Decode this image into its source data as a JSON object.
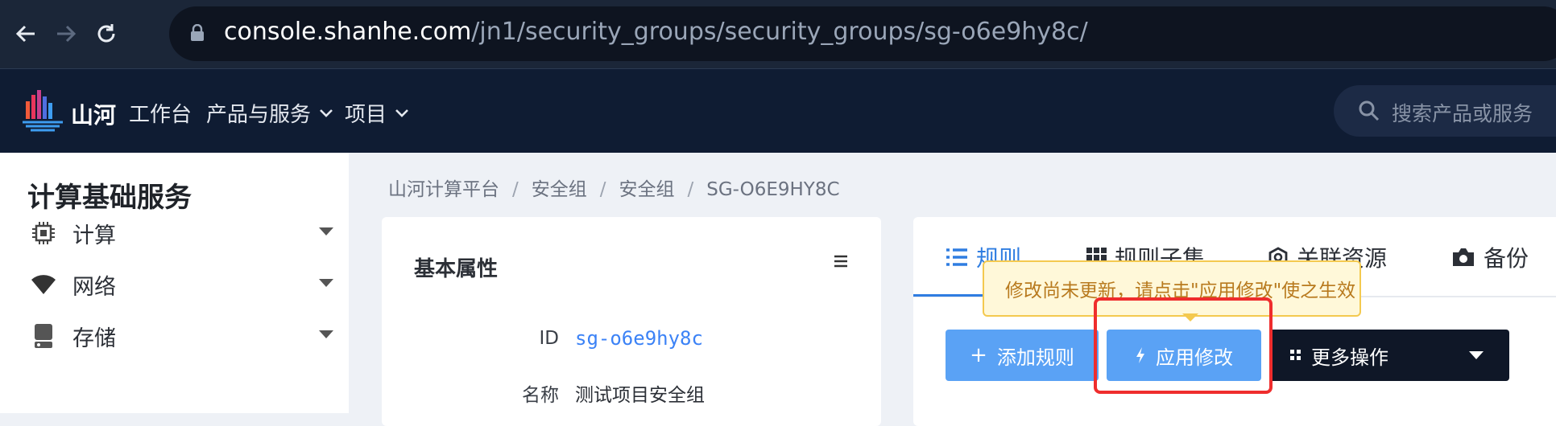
{
  "browser": {
    "url_host": "console.shanhe.com",
    "url_path": "/jn1/security_groups/security_groups/sg-o6e9hy8c/"
  },
  "topbar": {
    "brand": "山河",
    "nav": [
      {
        "label": "工作台"
      },
      {
        "label": "产品与服务"
      },
      {
        "label": "项目"
      }
    ],
    "search_placeholder": "搜索产品或服务"
  },
  "sidebar": {
    "title": "计算基础服务",
    "items": [
      {
        "label": "计算",
        "icon": "cpu-icon"
      },
      {
        "label": "网络",
        "icon": "wifi-icon"
      },
      {
        "label": "存储",
        "icon": "storage-icon"
      }
    ]
  },
  "breadcrumb": [
    "山河计算平台",
    "安全组",
    "安全组",
    "SG-O6E9HY8C"
  ],
  "basic_props": {
    "title": "基本属性",
    "fields": [
      {
        "label": "ID",
        "value": "sg-o6e9hy8c"
      },
      {
        "label": "名称",
        "value": "测试项目安全组"
      }
    ]
  },
  "tabs": [
    {
      "label": "规则",
      "icon": "list-icon",
      "active": true
    },
    {
      "label": "规则子集",
      "icon": "grid-icon"
    },
    {
      "label": "关联资源",
      "icon": "link-icon"
    },
    {
      "label": "备份",
      "icon": "camera-icon"
    }
  ],
  "actions": {
    "add_rule": "添加规则",
    "apply": "应用修改",
    "more": "更多操作"
  },
  "tooltip": "修改尚未更新，请点击\"应用修改\"使之生效",
  "colors": {
    "accent": "#2f7de1",
    "button_blue": "#5aa2f5",
    "tooltip_bg": "#fff8d9",
    "highlight_red": "#ef2d2d"
  }
}
